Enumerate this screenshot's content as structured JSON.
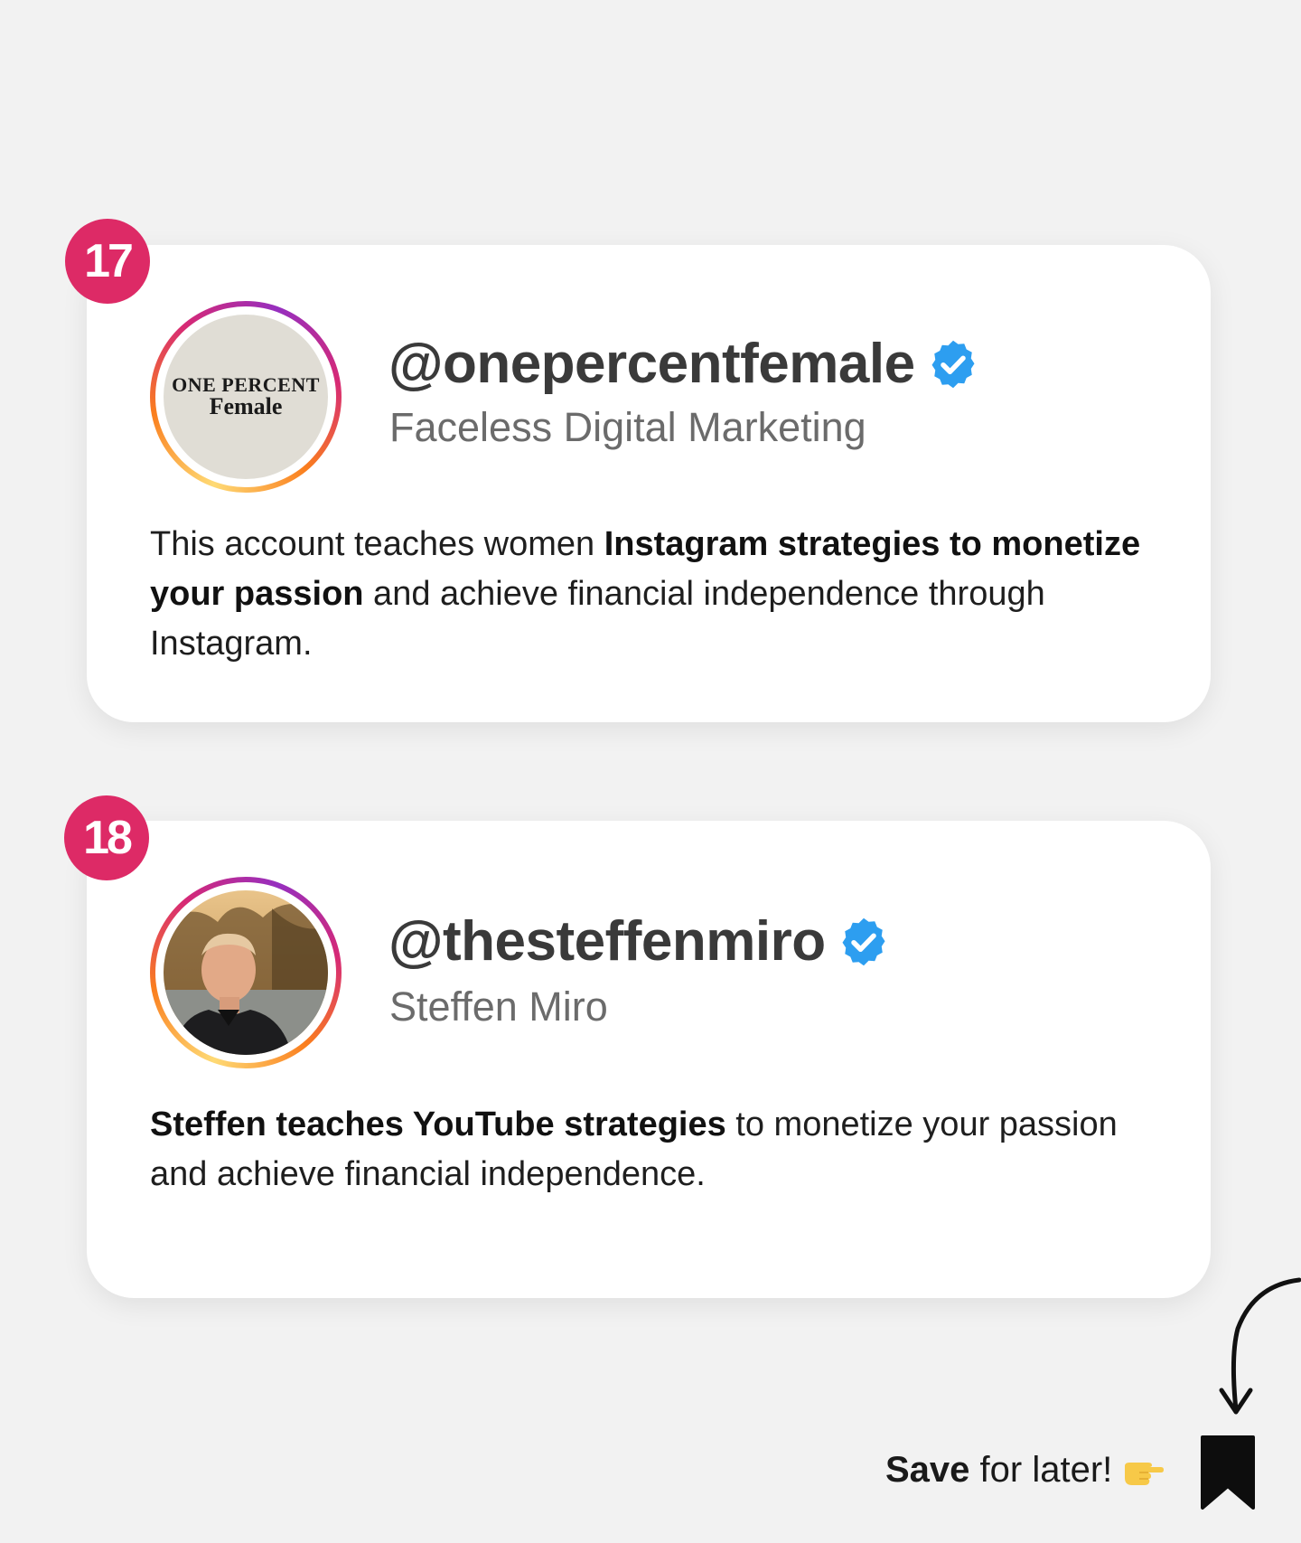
{
  "items": [
    {
      "number": "17",
      "handle": "@onepercentfemale",
      "subtitle": "Faceless Digital Marketing",
      "avatar": {
        "type": "logo",
        "line1": "ONE PERCENT",
        "line2": "Female"
      },
      "verified_icon": "verified-badge-icon",
      "description": {
        "part1": "This account teaches women ",
        "bold1": "Instagram strategies to monetize your passion",
        "part2": " and achieve financial independence through Instagram."
      }
    },
    {
      "number": "18",
      "handle": "@thesteffenmiro",
      "subtitle": "Steffen Miro",
      "avatar": {
        "type": "photo"
      },
      "verified_icon": "verified-badge-icon",
      "description": {
        "bold1": "Steffen teaches YouTube strategies",
        "part2": " to monetize your passion and achieve financial independence."
      }
    }
  ],
  "footer": {
    "save_bold": "Save",
    "save_rest": " for later!",
    "pointing_icon": "pointing-right-hand-icon",
    "bookmark_icon": "bookmark-icon",
    "arrow_icon": "curved-arrow-down-icon"
  },
  "colors": {
    "background": "#f2f2f2",
    "badge": "#dd2a66",
    "verified": "#2d9ef0",
    "handle": "#3a3a3a",
    "subtitle": "#6b6b6b"
  }
}
